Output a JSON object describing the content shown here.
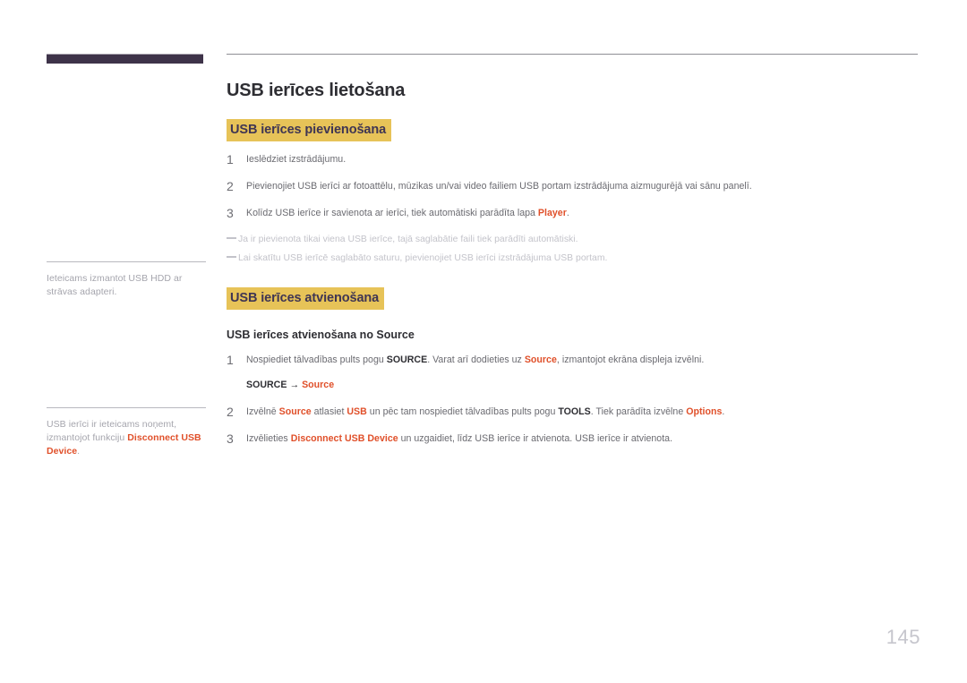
{
  "document": {
    "page_number": "145",
    "accent_color": "#e0502a",
    "highlight_color": "#e7c358",
    "brand_bar_color": "#3e3349",
    "heading_text_color": "#3f3553"
  },
  "sidebar": {
    "notes": [
      {
        "id": "usb-hdd-note",
        "segments": [
          {
            "text": "Ieteicams izmantot USB HDD ar strāvas adapteri.",
            "style": "plain"
          }
        ]
      },
      {
        "id": "disconnect-usb-note",
        "segments": [
          {
            "text": "USB ierīci ir ieteicams noņemt, izmantojot funkciju ",
            "style": "plain"
          },
          {
            "text": "Disconnect USB Device",
            "style": "accent"
          },
          {
            "text": ".",
            "style": "plain"
          }
        ]
      }
    ]
  },
  "main": {
    "title": "USB ierīces lietošana",
    "sections": [
      {
        "id": "connecting",
        "heading": "USB ierīces pievienošana",
        "steps": [
          {
            "number": "1",
            "segments": [
              {
                "text": "Ieslēdziet izstrādājumu.",
                "style": "plain"
              }
            ]
          },
          {
            "number": "2",
            "segments": [
              {
                "text": "Pievienojiet USB ierīci ar fotoattēlu, mūzikas un/vai video failiem USB portam izstrādājuma aizmugurējā vai sānu panelī.",
                "style": "plain"
              }
            ]
          },
          {
            "number": "3",
            "segments": [
              {
                "text": "Kolīdz USB ierīce ir savienota ar ierīci, tiek automātiski parādīta lapa ",
                "style": "plain"
              },
              {
                "text": "Player",
                "style": "accent"
              },
              {
                "text": ".",
                "style": "plain"
              }
            ]
          }
        ],
        "notes": [
          "Ja ir pievienota tikai viena USB ierīce, tajā saglabātie faili tiek parādīti automātiski.",
          "Lai skatītu USB ierīcē saglabāto saturu, pievienojiet USB ierīci izstrādājuma USB portam."
        ]
      },
      {
        "id": "disconnecting",
        "heading": "USB ierīces atvienošana",
        "sub_heading": "USB ierīces atvienošana no Source",
        "steps": [
          {
            "number": "1",
            "segments": [
              {
                "text": "Nospiediet tālvadības pults pogu ",
                "style": "plain"
              },
              {
                "text": "SOURCE",
                "style": "bold"
              },
              {
                "text": ". Varat arī dodieties uz ",
                "style": "plain"
              },
              {
                "text": "Source",
                "style": "accent"
              },
              {
                "text": ", izmantojot ekrāna displeja izvēlni.",
                "style": "plain"
              }
            ],
            "path": {
              "source_label": "SOURCE",
              "arrow": "→",
              "target_label": "Source"
            }
          },
          {
            "number": "2",
            "segments": [
              {
                "text": "Izvēlnē ",
                "style": "plain"
              },
              {
                "text": "Source",
                "style": "accent"
              },
              {
                "text": " atlasiet ",
                "style": "plain"
              },
              {
                "text": "USB",
                "style": "accent"
              },
              {
                "text": " un pēc tam nospiediet tālvadības pults pogu ",
                "style": "plain"
              },
              {
                "text": "TOOLS",
                "style": "bold"
              },
              {
                "text": ". Tiek parādīta izvēlne ",
                "style": "plain"
              },
              {
                "text": "Options",
                "style": "accent"
              },
              {
                "text": ".",
                "style": "plain"
              }
            ]
          },
          {
            "number": "3",
            "segments": [
              {
                "text": "Izvēlieties ",
                "style": "plain"
              },
              {
                "text": "Disconnect USB Device",
                "style": "accent"
              },
              {
                "text": " un uzgaidiet, līdz USB ierīce ir atvienota. USB ierīce ir atvienota.",
                "style": "plain"
              }
            ]
          }
        ]
      }
    ]
  }
}
